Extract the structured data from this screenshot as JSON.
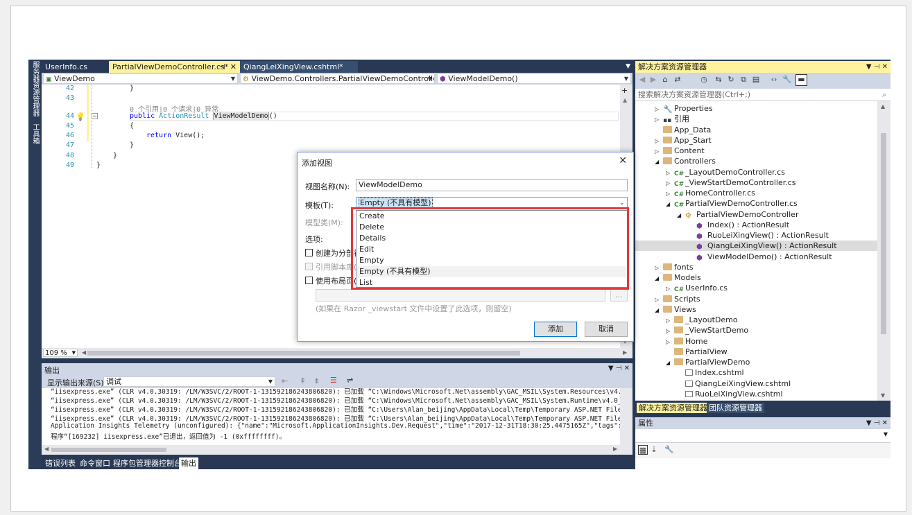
{
  "vertical_tabs": [
    "服务器资源管理器",
    "工具箱"
  ],
  "editor_tabs": [
    {
      "label": "UserInfo.cs"
    },
    {
      "label": "PartialViewDemoController.cs*"
    },
    {
      "label": "QiangLeiXingView.cshtml*"
    }
  ],
  "editor_tab_pin": "⊣",
  "editor_tab_close": "✕",
  "navbar": {
    "project": "ViewDemo",
    "class": "ViewDemo.Controllers.PartialViewDemoController",
    "member": "ViewModelDemo()"
  },
  "code_lines": [
    {
      "num": "42",
      "text": "}"
    },
    {
      "num": "43",
      "text": ""
    },
    {
      "num": "",
      "text": "0 个引用|0 个请求|0 异常"
    },
    {
      "num": "44",
      "text_kw": "public",
      "text_ty": "ActionResult",
      "text_name": "ViewModelDemo",
      "text_rest": "()"
    },
    {
      "num": "45",
      "text": "{"
    },
    {
      "num": "46",
      "text_kw": "return",
      "text_rest": " View();"
    },
    {
      "num": "47",
      "text": "}"
    },
    {
      "num": "48",
      "text": "}"
    },
    {
      "num": "49",
      "text": "}"
    }
  ],
  "zoom": "109 %",
  "output": {
    "title": "输出",
    "source_label": "显示输出来源(S):",
    "source_value": "调试",
    "lines": [
      "“iisexpress.exe” (CLR v4.0.30319: /LM/W3SVC/2/ROOT-1-131592186243806820): 已加载 “C:\\Windows\\Microsoft.Net\\assembly\\GAC_MSIL\\System.Resources\\v4.0_4.0.0.0_",
      "“iisexpress.exe” (CLR v4.0.30319: /LM/W3SVC/2/ROOT-1-131592186243806820): 已加载 “C:\\Windows\\Microsoft.Net\\assembly\\GAC_MSIL\\System.Runtime\\v4.0_4.0.0.0__b",
      "“iisexpress.exe” (CLR v4.0.30319: /LM/W3SVC/2/ROOT-1-131592186243806820): 已加载 “C:\\Users\\Alan_beijing\\AppData\\Local\\Temp\\Temporary ASP.NET Files\\vs\\6a8c",
      "“iisexpress.exe” (CLR v4.0.30319: /LM/W3SVC/2/ROOT-1-131592186243806820): 已加载 “C:\\Users\\Alan_beijing\\AppData\\Local\\Temp\\Temporary ASP.NET Files\\vs\\6a8c",
      "Application Insights Telemetry (unconfigured): {\"name\":\"Microsoft.ApplicationInsights.Dev.Request\",\"time\":\"2017-12-31T18:30:25.4475165Z\",\"tags\":{\"ai.operati",
      "程序“[169232] iisexpress.exe”已退出，返回值为 -1 (0xffffffff)。"
    ]
  },
  "bottom_tabs": [
    "错误列表",
    "命令窗口",
    "程序包管理器控制台",
    "输出"
  ],
  "solution_explorer": {
    "title": "解决方案资源管理器",
    "search_placeholder": "搜索解决方案资源管理器(Ctrl+;)",
    "tree": [
      {
        "label": "Properties",
        "icon": "wrench-icon",
        "exp": "▷"
      },
      {
        "label": "引用",
        "icon": "reference-icon",
        "exp": "▷"
      },
      {
        "label": "App_Data",
        "icon": "folder-icon",
        "exp": ""
      },
      {
        "label": "App_Start",
        "icon": "folder-icon",
        "exp": "▷"
      },
      {
        "label": "Content",
        "icon": "folder-icon",
        "exp": "▷"
      },
      {
        "label": "Controllers",
        "icon": "folder-icon",
        "exp": "◢"
      },
      {
        "label": "_LayoutDemoController.cs",
        "icon": "csharp-file-icon",
        "exp": "▷"
      },
      {
        "label": "_ViewStartDemoController.cs",
        "icon": "csharp-file-icon",
        "exp": "▷"
      },
      {
        "label": "HomeController.cs",
        "icon": "csharp-file-icon",
        "exp": "▷"
      },
      {
        "label": "PartialViewDemoController.cs",
        "icon": "csharp-file-icon",
        "exp": "◢"
      },
      {
        "label": "PartialViewDemoController",
        "icon": "class-icon",
        "exp": "◢"
      },
      {
        "label": "Index() : ActionResult",
        "icon": "method-icon",
        "exp": ""
      },
      {
        "label": "RuoLeiXingView() : ActionResult",
        "icon": "method-icon",
        "exp": ""
      },
      {
        "label": "QiangLeiXingView() : ActionResult",
        "icon": "method-icon",
        "exp": ""
      },
      {
        "label": "ViewModelDemo() : ActionResult",
        "icon": "method-icon",
        "exp": ""
      },
      {
        "label": "fonts",
        "icon": "folder-icon",
        "exp": "▷"
      },
      {
        "label": "Models",
        "icon": "folder-icon",
        "exp": "◢"
      },
      {
        "label": "UserInfo.cs",
        "icon": "csharp-file-icon",
        "exp": "▷"
      },
      {
        "label": "Scripts",
        "icon": "folder-icon",
        "exp": "▷"
      },
      {
        "label": "Views",
        "icon": "folder-icon",
        "exp": "◢"
      },
      {
        "label": "_LayoutDemo",
        "icon": "folder-icon",
        "exp": "▷"
      },
      {
        "label": "_ViewStartDemo",
        "icon": "folder-icon",
        "exp": "▷"
      },
      {
        "label": "Home",
        "icon": "folder-icon",
        "exp": "▷"
      },
      {
        "label": "PartialView",
        "icon": "folder-icon",
        "exp": ""
      },
      {
        "label": "PartialViewDemo",
        "icon": "folder-icon",
        "exp": "◢"
      },
      {
        "label": "Index.cshtml",
        "icon": "cshtml-file-icon",
        "exp": ""
      },
      {
        "label": "QiangLeiXingView.cshtml",
        "icon": "cshtml-file-icon",
        "exp": ""
      },
      {
        "label": "RuoLeiXingView.cshtml",
        "icon": "cshtml-file-icon",
        "exp": ""
      }
    ],
    "tabs": [
      "解决方案资源管理器",
      "团队资源管理器"
    ]
  },
  "properties": {
    "title": "属性"
  },
  "dialog": {
    "title": "添加视图",
    "view_name_label": "视图名称(N):",
    "view_name_value": "ViewModelDemo",
    "template_label": "模板(T):",
    "template_value": "Empty (不具有模型)",
    "model_class_label": "模型类(M):",
    "options_label": "选项:",
    "option_partial": "创建为分部视图",
    "option_scripts": "引用脚本库(R)",
    "option_layout": "使用布局页(U):",
    "layout_hint": "(如果在 Razor _viewstart 文件中设置了此选项，则留空)",
    "browse": "...",
    "add_button": "添加",
    "cancel_button": "取消",
    "template_options": [
      "Create",
      "Delete",
      "Details",
      "Edit",
      "Empty",
      "Empty (不具有模型)",
      "List"
    ]
  },
  "colors": {
    "accent_tab": "#fff29d",
    "ide_dark": "#293955",
    "highlight_box": "#e2383a"
  }
}
